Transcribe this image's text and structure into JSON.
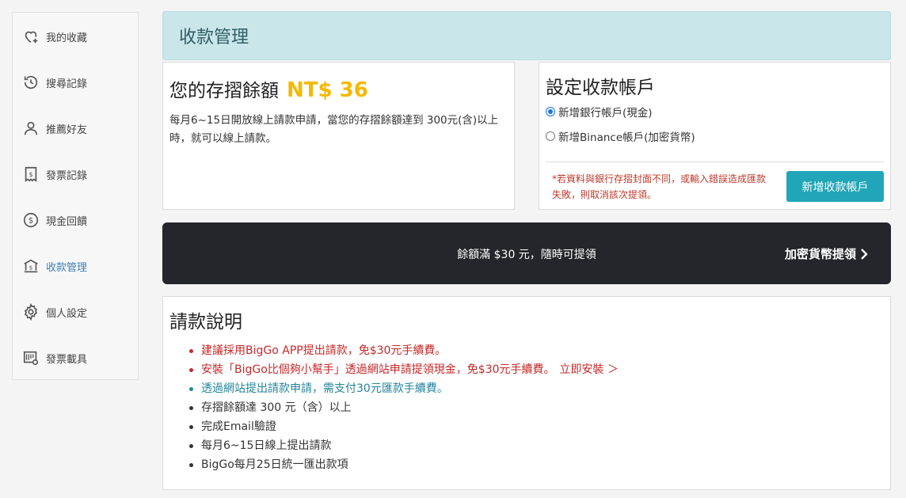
{
  "sidebar": {
    "items": [
      {
        "label": "我的收藏",
        "icon": "heart-plus-icon"
      },
      {
        "label": "搜尋記錄",
        "icon": "history-icon"
      },
      {
        "label": "推薦好友",
        "icon": "user-icon"
      },
      {
        "label": "發票記錄",
        "icon": "receipt-icon"
      },
      {
        "label": "現金回饋",
        "icon": "dollar-coin-icon"
      },
      {
        "label": "收款管理",
        "icon": "bank-icon",
        "active": true
      },
      {
        "label": "個人設定",
        "icon": "gear-icon"
      },
      {
        "label": "發票載具",
        "icon": "barcode-gear-icon"
      }
    ]
  },
  "header": {
    "title": "收款管理"
  },
  "balance": {
    "label": "您的存摺餘額",
    "amount": "NT$ 36",
    "description": "每月6~15日開放線上請款申請，當您的存摺餘額達到 300元(含)以上時，就可以線上請款。"
  },
  "account": {
    "title": "設定收款帳戶",
    "options": [
      {
        "label": "新增銀行帳戶(現金)",
        "checked": true
      },
      {
        "label": "新增Binance帳戶(加密貨幣)",
        "checked": false
      }
    ],
    "warning": "*若資料與銀行存摺封面不同，或輸入錯誤造成匯款失敗，則取消該次提領。",
    "add_button": "新增收款帳戶"
  },
  "banner": {
    "text": "餘額滿 $30 元，隨時可提領",
    "link": "加密貨幣提領"
  },
  "instructions": {
    "title": "請款說明",
    "items": [
      {
        "text": "建議採用BigGo APP提出請款，免$30元手續費。",
        "style": "red"
      },
      {
        "text": "安裝「BigGo比個夠小幫手」透過網站申請提領現金，免$30元手續費。",
        "style": "red",
        "link": "立即安裝 ＞"
      },
      {
        "text": "透過網站提出請款申請，需支付30元匯款手續費。",
        "style": "teal"
      },
      {
        "text": "存摺餘額達 300 元（含）以上",
        "style": "normal"
      },
      {
        "text": "完成Email驗證",
        "style": "normal"
      },
      {
        "text": "每月6~15日線上提出請款",
        "style": "normal"
      },
      {
        "text": "BigGo每月25日統一匯出款項",
        "style": "normal"
      }
    ]
  },
  "colors": {
    "accent_teal": "#20a6b8",
    "header_bg": "#c9e6ea",
    "amount_yellow": "#f5b800",
    "warning_red": "#c62828",
    "banner_bg": "#25262b",
    "active_nav": "#3d7fb6"
  }
}
